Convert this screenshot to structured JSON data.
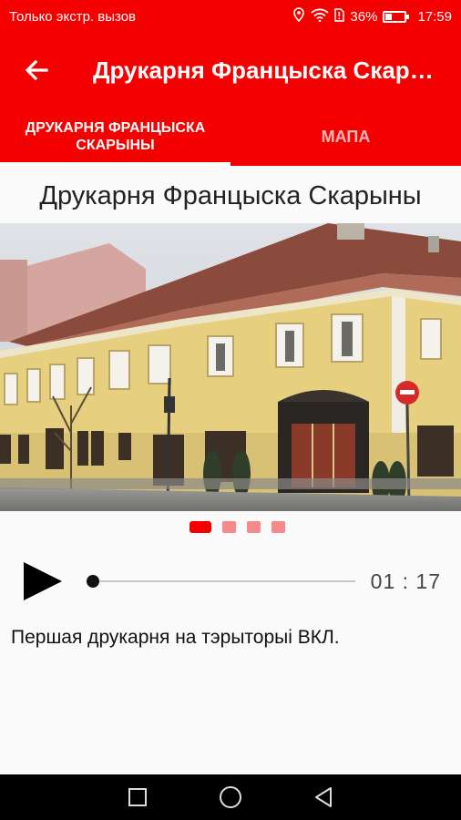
{
  "status_bar": {
    "carrier_text": "Только экстр. вызов",
    "battery": "36%",
    "time": "17:59",
    "battery_level": 0.36,
    "icons": [
      "location-icon",
      "wifi-icon",
      "sim-icon",
      "battery-icon"
    ]
  },
  "app_bar": {
    "title": "Друкарня Францыска Скарыны",
    "back_icon": "arrow-left-icon"
  },
  "tabs": [
    {
      "label": "ДРУКАРНЯ ФРАНЦЫСКА СКАРЫНЫ",
      "active": true
    },
    {
      "label": "МАПА",
      "active": false
    }
  ],
  "place": {
    "title": "Друкарня Францыска Скарыны",
    "description": "Першая друкарня на тэрыторыі ВКЛ."
  },
  "gallery": {
    "pages": 4,
    "current": 1
  },
  "player": {
    "time": "01 : 17",
    "progress": 0.0,
    "play_icon": "play-icon"
  },
  "nav_bar": {
    "icons": [
      "recents-square-icon",
      "home-circle-icon",
      "back-triangle-icon"
    ]
  },
  "colors": {
    "accent": "#f40000",
    "dot_inactive": "#f58a8a"
  }
}
